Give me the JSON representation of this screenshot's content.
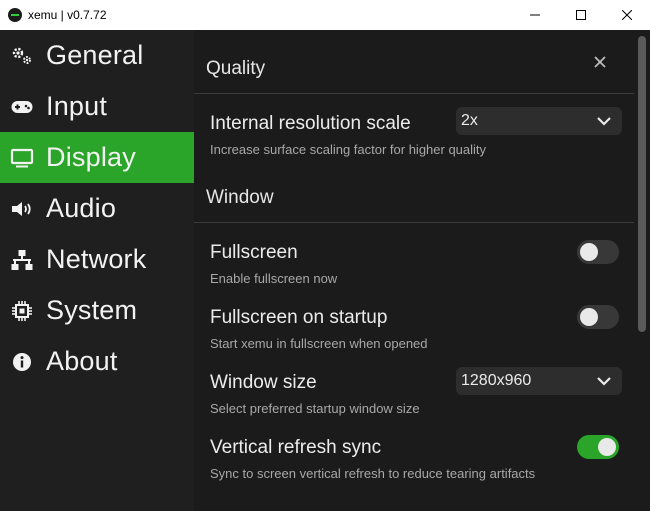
{
  "window": {
    "title": "xemu | v0.7.72"
  },
  "sidebar": {
    "items": [
      {
        "label": "General",
        "icon": "gears-icon"
      },
      {
        "label": "Input",
        "icon": "gamepad-icon"
      },
      {
        "label": "Display",
        "icon": "monitor-icon",
        "active": true
      },
      {
        "label": "Audio",
        "icon": "speaker-icon"
      },
      {
        "label": "Network",
        "icon": "network-icon"
      },
      {
        "label": "System",
        "icon": "chip-icon"
      },
      {
        "label": "About",
        "icon": "info-icon"
      }
    ]
  },
  "main": {
    "quality": {
      "title": "Quality",
      "resolution": {
        "label": "Internal resolution scale",
        "desc": "Increase surface scaling factor for higher quality",
        "value": "2x"
      }
    },
    "window": {
      "title": "Window",
      "fullscreen": {
        "label": "Fullscreen",
        "desc": "Enable fullscreen now",
        "enabled": false
      },
      "fullscreen_startup": {
        "label": "Fullscreen on startup",
        "desc": "Start xemu in fullscreen when opened",
        "enabled": false
      },
      "window_size": {
        "label": "Window size",
        "desc": "Select preferred startup window size",
        "value": "1280x960"
      },
      "vsync": {
        "label": "Vertical refresh sync",
        "desc": "Sync to screen vertical refresh to reduce tearing artifacts",
        "enabled": true
      }
    }
  },
  "colors": {
    "accent": "#2aa52a",
    "background": "#1b1b1b",
    "sidebar": "#1f1f1f",
    "control": "#2d2d2d"
  }
}
